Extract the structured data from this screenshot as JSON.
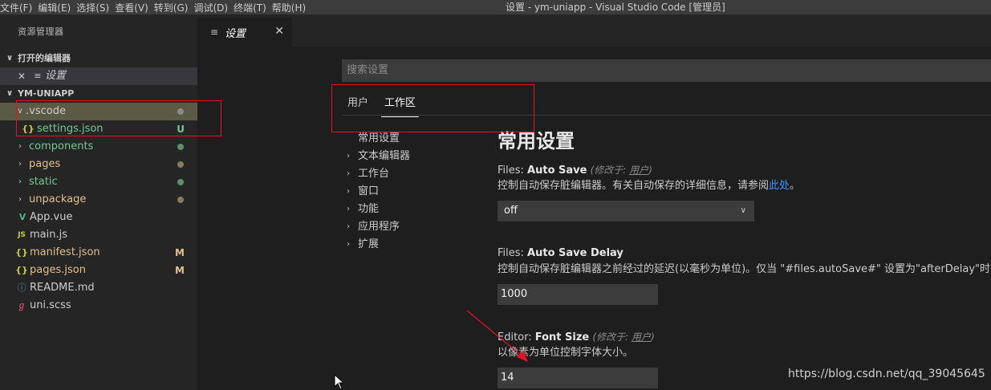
{
  "menubar": {
    "items": [
      "文件(F)",
      "编辑(E)",
      "选择(S)",
      "查看(V)",
      "转到(G)",
      "调试(D)",
      "终端(T)",
      "帮助(H)"
    ],
    "window_title": "设置 - ym-uniapp - Visual Studio Code [管理员]"
  },
  "sidebar": {
    "title": "资源管理器",
    "open_editors": {
      "header": "打开的编辑器",
      "items": [
        {
          "label": "设置",
          "close": "✕",
          "icon": "settings-file-icon"
        }
      ]
    },
    "project": {
      "header": "YM-UNIAPP",
      "vscode_folder": {
        "label": ".vscode"
      },
      "settings_json": {
        "label": "settings.json",
        "icon_text": "{}",
        "badge": "U"
      },
      "folders": [
        {
          "label": "components"
        },
        {
          "label": "pages"
        },
        {
          "label": "static"
        },
        {
          "label": "unpackage"
        }
      ],
      "files": [
        {
          "label": "App.vue",
          "icon_text": "V"
        },
        {
          "label": "main.js",
          "icon_text": "JS"
        },
        {
          "label": "manifest.json",
          "icon_text": "{}",
          "badge": "M"
        },
        {
          "label": "pages.json",
          "icon_text": "{}",
          "badge": "M"
        },
        {
          "label": "README.md",
          "icon_text": "ⓘ"
        },
        {
          "label": "uni.scss",
          "icon_text": "ℊ"
        }
      ]
    }
  },
  "tab": {
    "label": "设置",
    "close": "✕"
  },
  "settings": {
    "search_placeholder": "搜索设置",
    "scope_tabs": [
      "用户",
      "工作区"
    ],
    "toc": [
      "常用设置",
      "文本编辑器",
      "工作台",
      "窗口",
      "功能",
      "应用程序",
      "扩展"
    ],
    "section_title": "常用设置",
    "auto_save": {
      "category": "Files:",
      "key": "Auto Save",
      "modified_prefix": "(修改于:",
      "modified_link": "用户",
      "modified_suffix": ")",
      "desc": "控制自动保存脏编辑器。有关自动保存的详细信息，请参阅",
      "desc_link": "此处",
      "desc_end": "。",
      "value": "off"
    },
    "auto_save_delay": {
      "category": "Files:",
      "key": "Auto Save Delay",
      "desc": "控制自动保存脏编辑器之前经过的延迟(以毫秒为单位)。仅当 \"#files.autoSave#\" 设置为\"afterDelay\"时才适用",
      "value": "1000"
    },
    "font_size": {
      "category": "Editor:",
      "key": "Font Size",
      "modified_prefix": "(修改于:",
      "modified_link": "用户",
      "modified_suffix": ")",
      "desc": "以像素为单位控制字体大小。",
      "value": "14"
    }
  },
  "watermark": "https://blog.csdn.net/qq_39045645",
  "colors": {
    "annotation_red": "#e81123",
    "untracked_green": "#73c991",
    "modified_yellow": "#e2c08d",
    "link_blue": "#3794ff"
  }
}
